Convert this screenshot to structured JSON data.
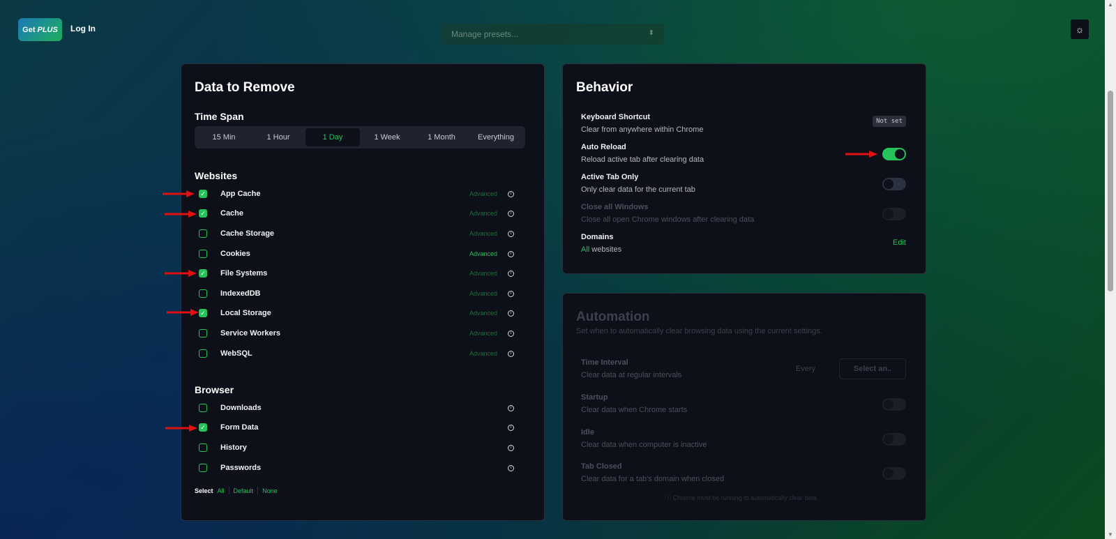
{
  "header": {
    "plus_get": "Get",
    "plus_plus": "PLUS",
    "login": "Log In",
    "presets_placeholder": "Manage presets..."
  },
  "data_card": {
    "title": "Data to Remove",
    "time_span_title": "Time Span",
    "time_options": [
      "15 Min",
      "1 Hour",
      "1 Day",
      "1 Week",
      "1 Month",
      "Everything"
    ],
    "selected_time": "1 Day",
    "websites_title": "Websites",
    "websites": [
      {
        "label": "App Cache",
        "checked": true,
        "advanced": "Advanced",
        "advanced_bright": false
      },
      {
        "label": "Cache",
        "checked": true,
        "advanced": "Advanced",
        "advanced_bright": false
      },
      {
        "label": "Cache Storage",
        "checked": false,
        "advanced": "Advanced",
        "advanced_bright": false
      },
      {
        "label": "Cookies",
        "checked": false,
        "advanced": "Advanced",
        "advanced_bright": true
      },
      {
        "label": "File Systems",
        "checked": true,
        "advanced": "Advanced",
        "advanced_bright": false
      },
      {
        "label": "IndexedDB",
        "checked": false,
        "advanced": "Advanced",
        "advanced_bright": false
      },
      {
        "label": "Local Storage",
        "checked": true,
        "advanced": "Advanced",
        "advanced_bright": false
      },
      {
        "label": "Service Workers",
        "checked": false,
        "advanced": "Advanced",
        "advanced_bright": false
      },
      {
        "label": "WebSQL",
        "checked": false,
        "advanced": "Advanced",
        "advanced_bright": false
      }
    ],
    "browser_title": "Browser",
    "browser": [
      {
        "label": "Downloads",
        "checked": false
      },
      {
        "label": "Form Data",
        "checked": true
      },
      {
        "label": "History",
        "checked": false
      },
      {
        "label": "Passwords",
        "checked": false
      }
    ],
    "select_label": "Select",
    "select_all": "All",
    "select_default": "Default",
    "select_none": "None"
  },
  "behavior": {
    "title": "Behavior",
    "keyboard_title": "Keyboard Shortcut",
    "keyboard_desc": "Clear from anywhere within Chrome",
    "keyboard_value": "Not set",
    "reload_title": "Auto Reload",
    "reload_desc": "Reload active tab after clearing data",
    "reload_on": true,
    "active_title": "Active Tab Only",
    "active_desc": "Only clear data for the current tab",
    "active_on": false,
    "close_title": "Close all Windows",
    "close_desc": "Close all open Chrome windows after clearing data",
    "domains_title": "Domains",
    "domains_all": "All",
    "domains_rest": "websites",
    "domains_edit": "Edit"
  },
  "automation": {
    "title": "Automation",
    "desc": "Set when to automatically clear browsing data using the current settings.",
    "interval_title": "Time Interval",
    "interval_desc": "Clear data at regular intervals",
    "every": "Every",
    "select_placeholder": "Select an..",
    "startup_title": "Startup",
    "startup_desc": "Clear data when Chrome starts",
    "idle_title": "Idle",
    "idle_desc": "Clear data when computer is inactive",
    "tabclosed_title": "Tab Closed",
    "tabclosed_desc": "Clear data for a tab's domain when closed",
    "footnote": "ⓘ Chrome must be running to automatically clear data"
  },
  "colors": {
    "accent": "#26c25a",
    "card_bg": "#0d1018",
    "arrow": "#e01010"
  }
}
